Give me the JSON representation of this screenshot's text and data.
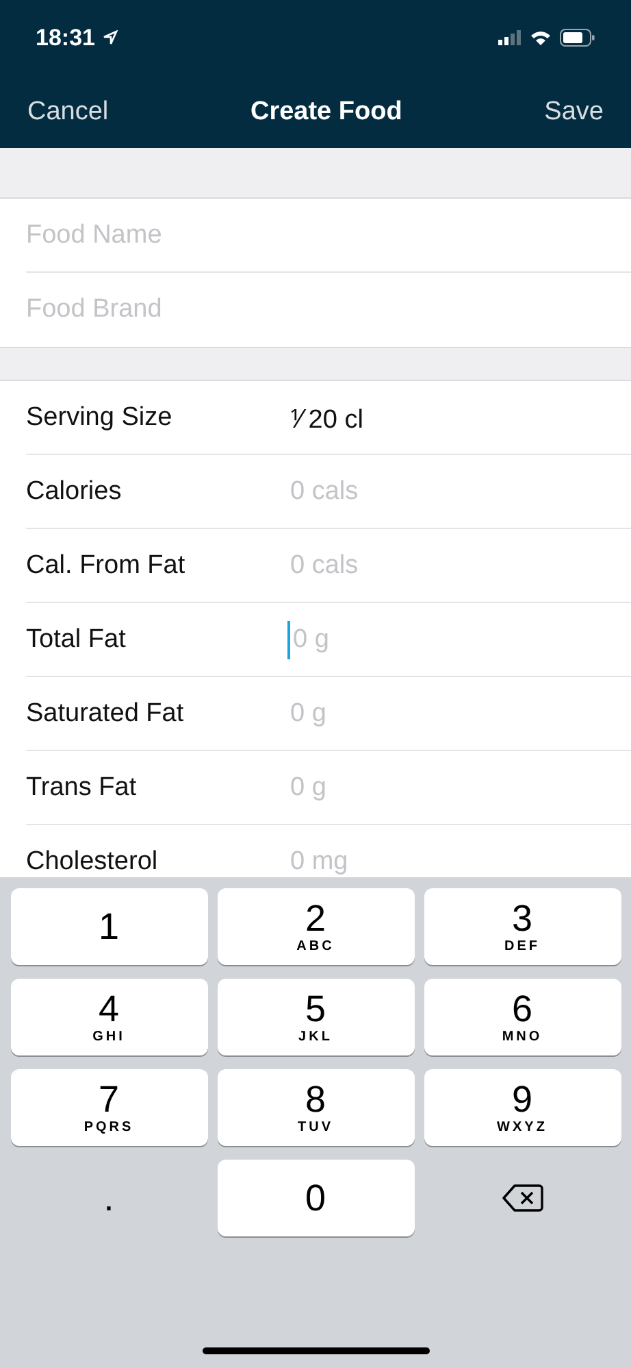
{
  "status_bar": {
    "time": "18:31"
  },
  "nav": {
    "cancel": "Cancel",
    "title": "Create Food",
    "save": "Save"
  },
  "name_fields": [
    {
      "placeholder": "Food Name"
    },
    {
      "placeholder": "Food Brand"
    }
  ],
  "nutrition_rows": [
    {
      "label": "Serving Size",
      "value": "⅟ 20 cl",
      "focused": false
    },
    {
      "label": "Calories",
      "placeholder": "0 cals",
      "focused": false
    },
    {
      "label": "Cal. From Fat",
      "placeholder": "0 cals",
      "focused": false
    },
    {
      "label": "Total Fat",
      "placeholder": "0 g",
      "focused": true
    },
    {
      "label": "Saturated Fat",
      "placeholder": "0 g",
      "focused": false
    },
    {
      "label": "Trans Fat",
      "placeholder": "0 g",
      "focused": false
    },
    {
      "label": "Cholesterol",
      "placeholder": "0 mg",
      "focused": false
    }
  ],
  "keypad": [
    {
      "digit": "1"
    },
    {
      "digit": "2",
      "letters": "ABC"
    },
    {
      "digit": "3",
      "letters": "DEF"
    },
    {
      "digit": "4",
      "letters": "GHI"
    },
    {
      "digit": "5",
      "letters": "JKL"
    },
    {
      "digit": "6",
      "letters": "MNO"
    },
    {
      "digit": "7",
      "letters": "PQRS"
    },
    {
      "digit": "8",
      "letters": "TUV"
    },
    {
      "digit": "9",
      "letters": "WXYZ"
    },
    {
      "digit": "0"
    }
  ],
  "decimal_key": "."
}
